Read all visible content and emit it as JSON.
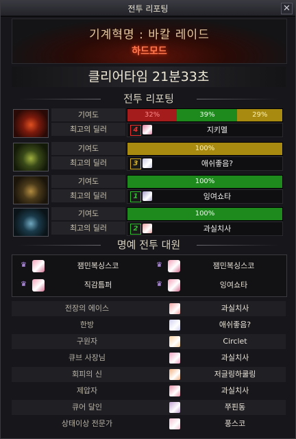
{
  "window": {
    "title": "전투 리포팅",
    "close_glyph": "✕"
  },
  "raid": {
    "name": "기계혁명 : 바칼 레이드",
    "difficulty": "하드모드"
  },
  "clear_time": "클리어타임 21분33초",
  "sections": {
    "report": "전투 리포팅",
    "honor": "명예 전투 대원"
  },
  "labels": {
    "contribution": "기여도",
    "best_dealer": "최고의 딜러"
  },
  "parties": [
    {
      "icon": "red-dragon-portrait-icon",
      "segments": [
        {
          "label": "32%",
          "fraction": 0.32,
          "color": "#a41c1c",
          "text": "#ff8a8a"
        },
        {
          "label": "39%",
          "fraction": 0.39,
          "color": "#1e8a1e",
          "text": "#e6ffe6"
        },
        {
          "label": "29%",
          "fraction": 0.29,
          "color": "#a88a10",
          "text": "#fff2b0"
        }
      ],
      "rank": "4",
      "rank_color": "#e83030",
      "dealer": "지키멜"
    },
    {
      "icon": "green-dragon-portrait-icon",
      "segments": [
        {
          "label": "100%",
          "fraction": 1.0,
          "color": "#a88a10",
          "text": "#fff2b0"
        }
      ],
      "rank": "3",
      "rank_color": "#d8b020",
      "dealer": "애쉬좋음?"
    },
    {
      "icon": "bronze-dragon-portrait-icon",
      "segments": [
        {
          "label": "100%",
          "fraction": 1.0,
          "color": "#1e8a1e",
          "text": "#e6ffe6"
        }
      ],
      "rank": "1",
      "rank_color": "#30c030",
      "dealer": "잉여쇼타"
    },
    {
      "icon": "blue-dragon-portrait-icon",
      "segments": [
        {
          "label": "100%",
          "fraction": 1.0,
          "color": "#1e8a1e",
          "text": "#e6ffe6"
        }
      ],
      "rank": "2",
      "rank_color": "#30c030",
      "dealer": "과실치사"
    }
  ],
  "honor": [
    {
      "crown": "♛",
      "name": "잼민복싱스코"
    },
    {
      "crown": "♛",
      "name": "잼민복싱스코"
    },
    {
      "crown": "♛",
      "name": "직감틈퍼"
    },
    {
      "crown": "♛",
      "name": "잉여쇼타"
    }
  ],
  "awards": [
    {
      "title": "전장의 에이스",
      "name": "과실치사"
    },
    {
      "title": "한방",
      "name": "애쉬좋음?"
    },
    {
      "title": "구원자",
      "name": "Circlet"
    },
    {
      "title": "큐브 사장님",
      "name": "과실치사"
    },
    {
      "title": "회피의 신",
      "name": "저글링하쿨링"
    },
    {
      "title": "제압자",
      "name": "과실치사"
    },
    {
      "title": "큐어 달인",
      "name": "쭈핀동"
    },
    {
      "title": "상태이상 전문가",
      "name": "풍스코"
    }
  ]
}
